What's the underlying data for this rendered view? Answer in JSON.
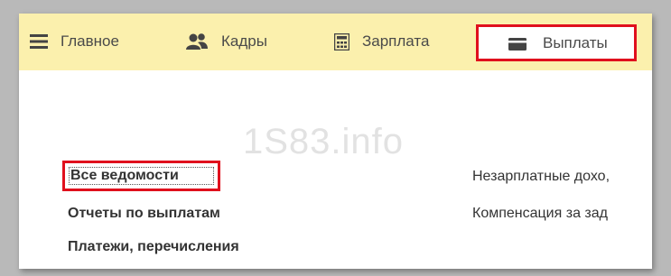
{
  "nav": {
    "items": [
      {
        "label": "Главное",
        "icon": "hamburger-menu-icon"
      },
      {
        "label": "Кадры",
        "icon": "users-icon"
      },
      {
        "label": "Зарплата",
        "icon": "calculator-icon"
      },
      {
        "label": "Выплаты",
        "icon": "wallet-icon",
        "active": true
      }
    ]
  },
  "watermark": "1S83.info",
  "main": {
    "left_links": [
      "Все ведомости",
      "Отчеты по выплатам",
      "Платежи, перечисления"
    ],
    "right_links": [
      "Незарплатные дохо,",
      "Компенсация за зад"
    ]
  },
  "colors": {
    "topbar_bg": "#fbf0ad",
    "highlight": "#e0101d",
    "text": "#333333"
  }
}
